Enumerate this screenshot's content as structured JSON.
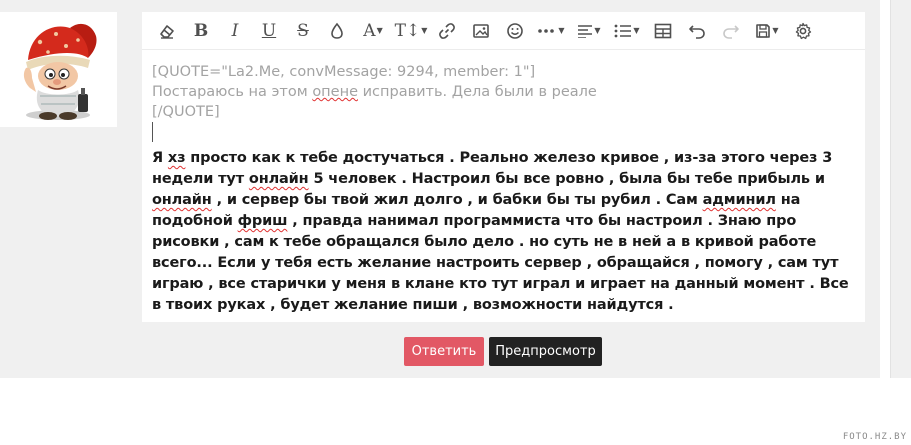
{
  "toolbar": {
    "icons": [
      "eraser-icon",
      "bold-icon",
      "italic-icon",
      "underline-icon",
      "strikethrough-icon",
      "color-icon",
      "font-family-icon",
      "font-size-icon",
      "link-icon",
      "image-icon",
      "smiley-icon",
      "more-icon",
      "align-icon",
      "list-icon",
      "table-icon",
      "undo-icon",
      "redo-icon",
      "save-icon",
      "settings-icon"
    ],
    "bold_label": "B",
    "italic_label": "I",
    "underline_label": "U",
    "strike_label": "S",
    "font_label": "A",
    "size_label": "T↕"
  },
  "quote": {
    "line1": "[QUOTE=\"La2.Me, convMessage: 9294, member: 1\"]",
    "line2_pre": "Постараюсь на этом ",
    "line2_sq": "опене",
    "line2_post": " исправить. Дела были в реале",
    "line3": "[/QUOTE]"
  },
  "message": {
    "p1": "Я ",
    "sq1": "хз",
    "p2": " просто как к тебе достучаться . Реально железо кривое , из-за этого через 3 недели тут ",
    "sq2": "онлайн",
    "p3": " 5 человек . Настроил бы все ровно , была бы тебе прибыль и ",
    "sq3": "онлайн",
    "p4": " , и сервер бы твой жил долго , и бабки бы ты рубил . Сам ",
    "sq4": "админил",
    "p5": " на подобной ",
    "sq5": "фриш",
    "p6": " , правда нанимал программиста что бы настроил . Знаю про рисовки , сам к тебе обращался было дело .  но суть не в ней а в кривой работе всего... Если у тебя есть желание  настроить сервер , обращайся , помогу , сам тут играю , все старички у меня в клане кто тут играл и играет на данный момент . Все в твоих руках , будет желание пиши , возможности найдутся ."
  },
  "actions": {
    "reply_label": "Ответить",
    "preview_label": "Предпросмотр"
  },
  "colors": {
    "reply_button": "#e25865",
    "preview_button": "#222222",
    "spell_underline": "#e03131"
  },
  "watermark": "FOTO.HZ.BY"
}
